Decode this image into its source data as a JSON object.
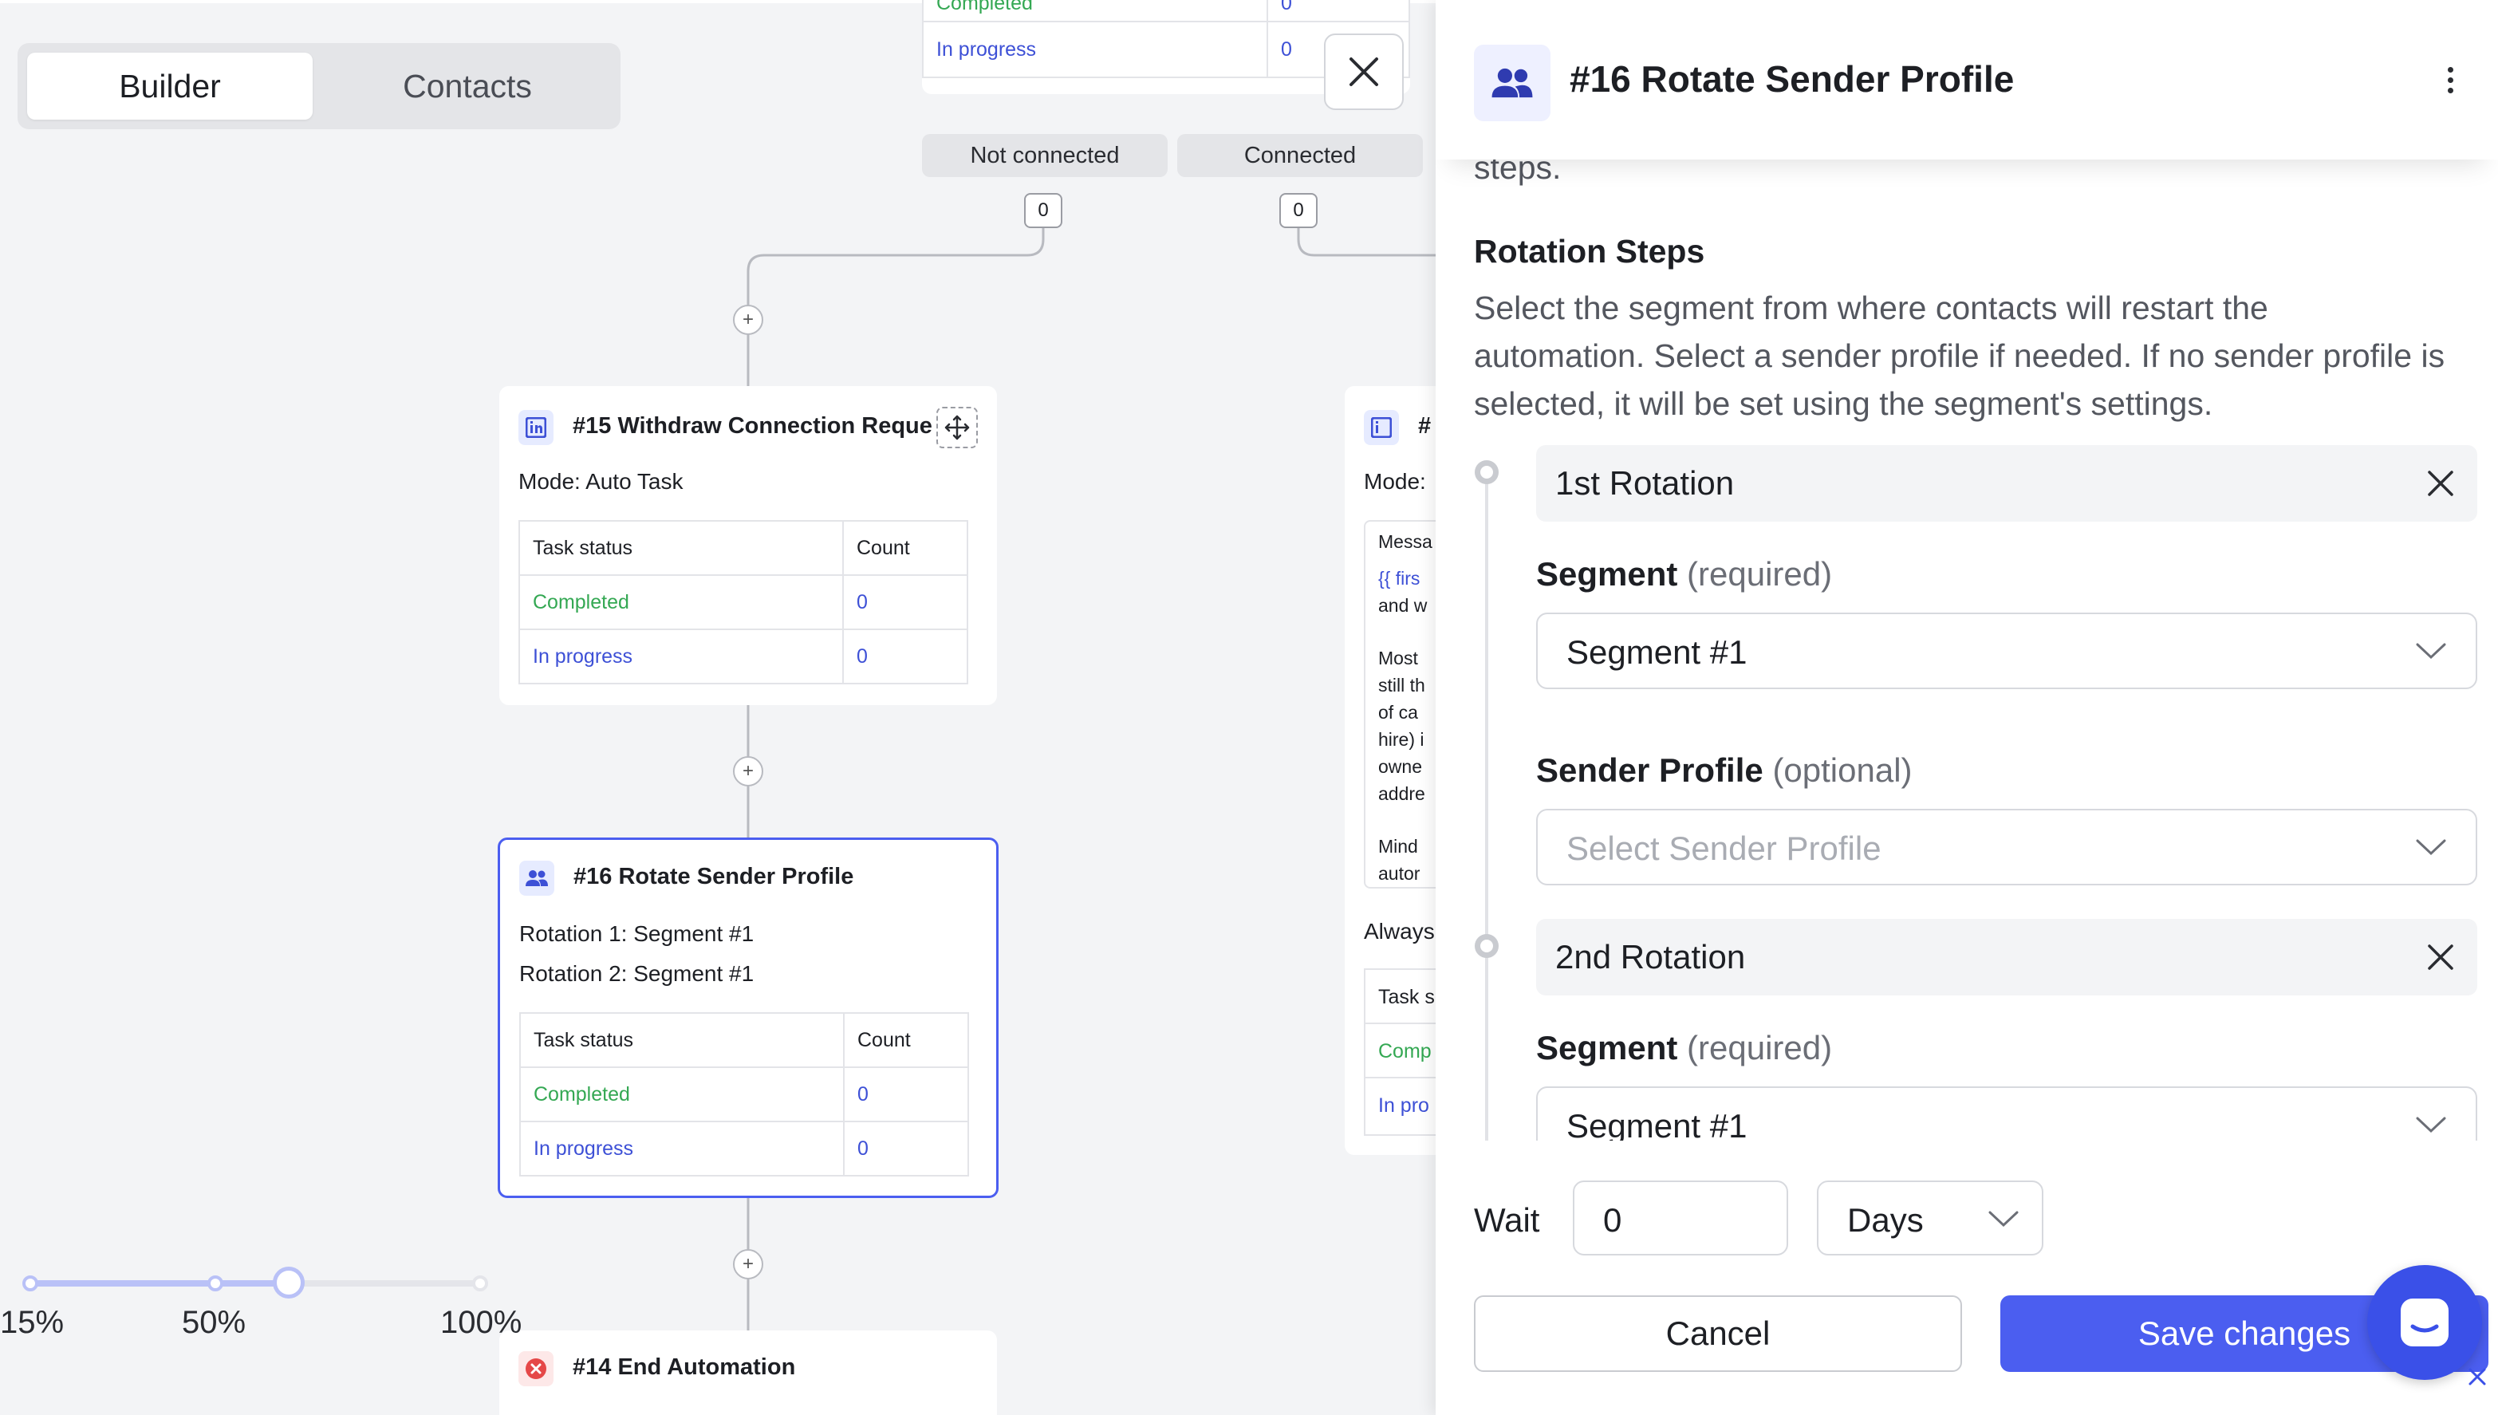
{
  "view_tabs": [
    "Builder",
    "Contacts"
  ],
  "top_table": {
    "completed": "Completed",
    "completed_count": "0",
    "in_progress": "In progress",
    "in_progress_count": "0"
  },
  "branches": {
    "not_connected": "Not connected",
    "connected": "Connected",
    "not_connected_count": "0",
    "connected_count": "0"
  },
  "node15": {
    "title": "#15 Withdraw Connection Reque",
    "mode_label": "Mode: ",
    "mode_value": "Auto Task",
    "table": {
      "header_status": "Task status",
      "header_count": "Count",
      "rows": [
        {
          "status": "Completed",
          "count": "0"
        },
        {
          "status": "In progress",
          "count": "0"
        }
      ]
    }
  },
  "node16": {
    "title": "#16 Rotate Sender Profile",
    "rotation1_label": "Rotation 1: ",
    "rotation1_value": "Segment #1",
    "rotation2_label": "Rotation 2: ",
    "rotation2_value": "Segment #1",
    "table": {
      "header_status": "Task status",
      "header_count": "Count",
      "rows": [
        {
          "status": "Completed",
          "count": "0"
        },
        {
          "status": "In progress",
          "count": "0"
        }
      ]
    }
  },
  "node14": {
    "title": "#14 End Automation"
  },
  "partial_node": {
    "title": "#",
    "mode": "Mode:",
    "message_lines": [
      "Messa",
      "{{ firs",
      "and w",
      "Most",
      "still th",
      "of ca",
      "hire) i",
      "owne",
      "addre",
      "Mind",
      "autor"
    ],
    "always": "Always",
    "task": "Task s",
    "comp": "Comp",
    "inprog": "In pro"
  },
  "zoom": {
    "labels": [
      "15%",
      "50%",
      "100%"
    ],
    "level": 0.57
  },
  "panel": {
    "title": "#16 Rotate Sender Profile",
    "cut_text": "steps.",
    "section_title": "Rotation Steps",
    "description": "Select the segment from where contacts will restart the automation. Select a sender profile if needed. If no sender profile is selected, it will be set using the segment's settings.",
    "rotations": [
      {
        "title": "1st Rotation",
        "segment_label": "Segment",
        "segment_hint": "(required)",
        "segment_value": "Segment #1",
        "sender_label": "Sender Profile",
        "sender_hint": "(optional)",
        "sender_placeholder": "Select Sender Profile"
      },
      {
        "title": "2nd Rotation",
        "segment_label": "Segment",
        "segment_hint": "(required)",
        "segment_value": "Segment #1"
      }
    ],
    "wait_label": "Wait",
    "wait_value": "0",
    "wait_unit": "Days",
    "cancel": "Cancel",
    "save": "Save changes"
  },
  "colors": {
    "accent": "#4b5ef0",
    "success": "#34a853",
    "link": "#3d50d6",
    "danger": "#e54848"
  }
}
